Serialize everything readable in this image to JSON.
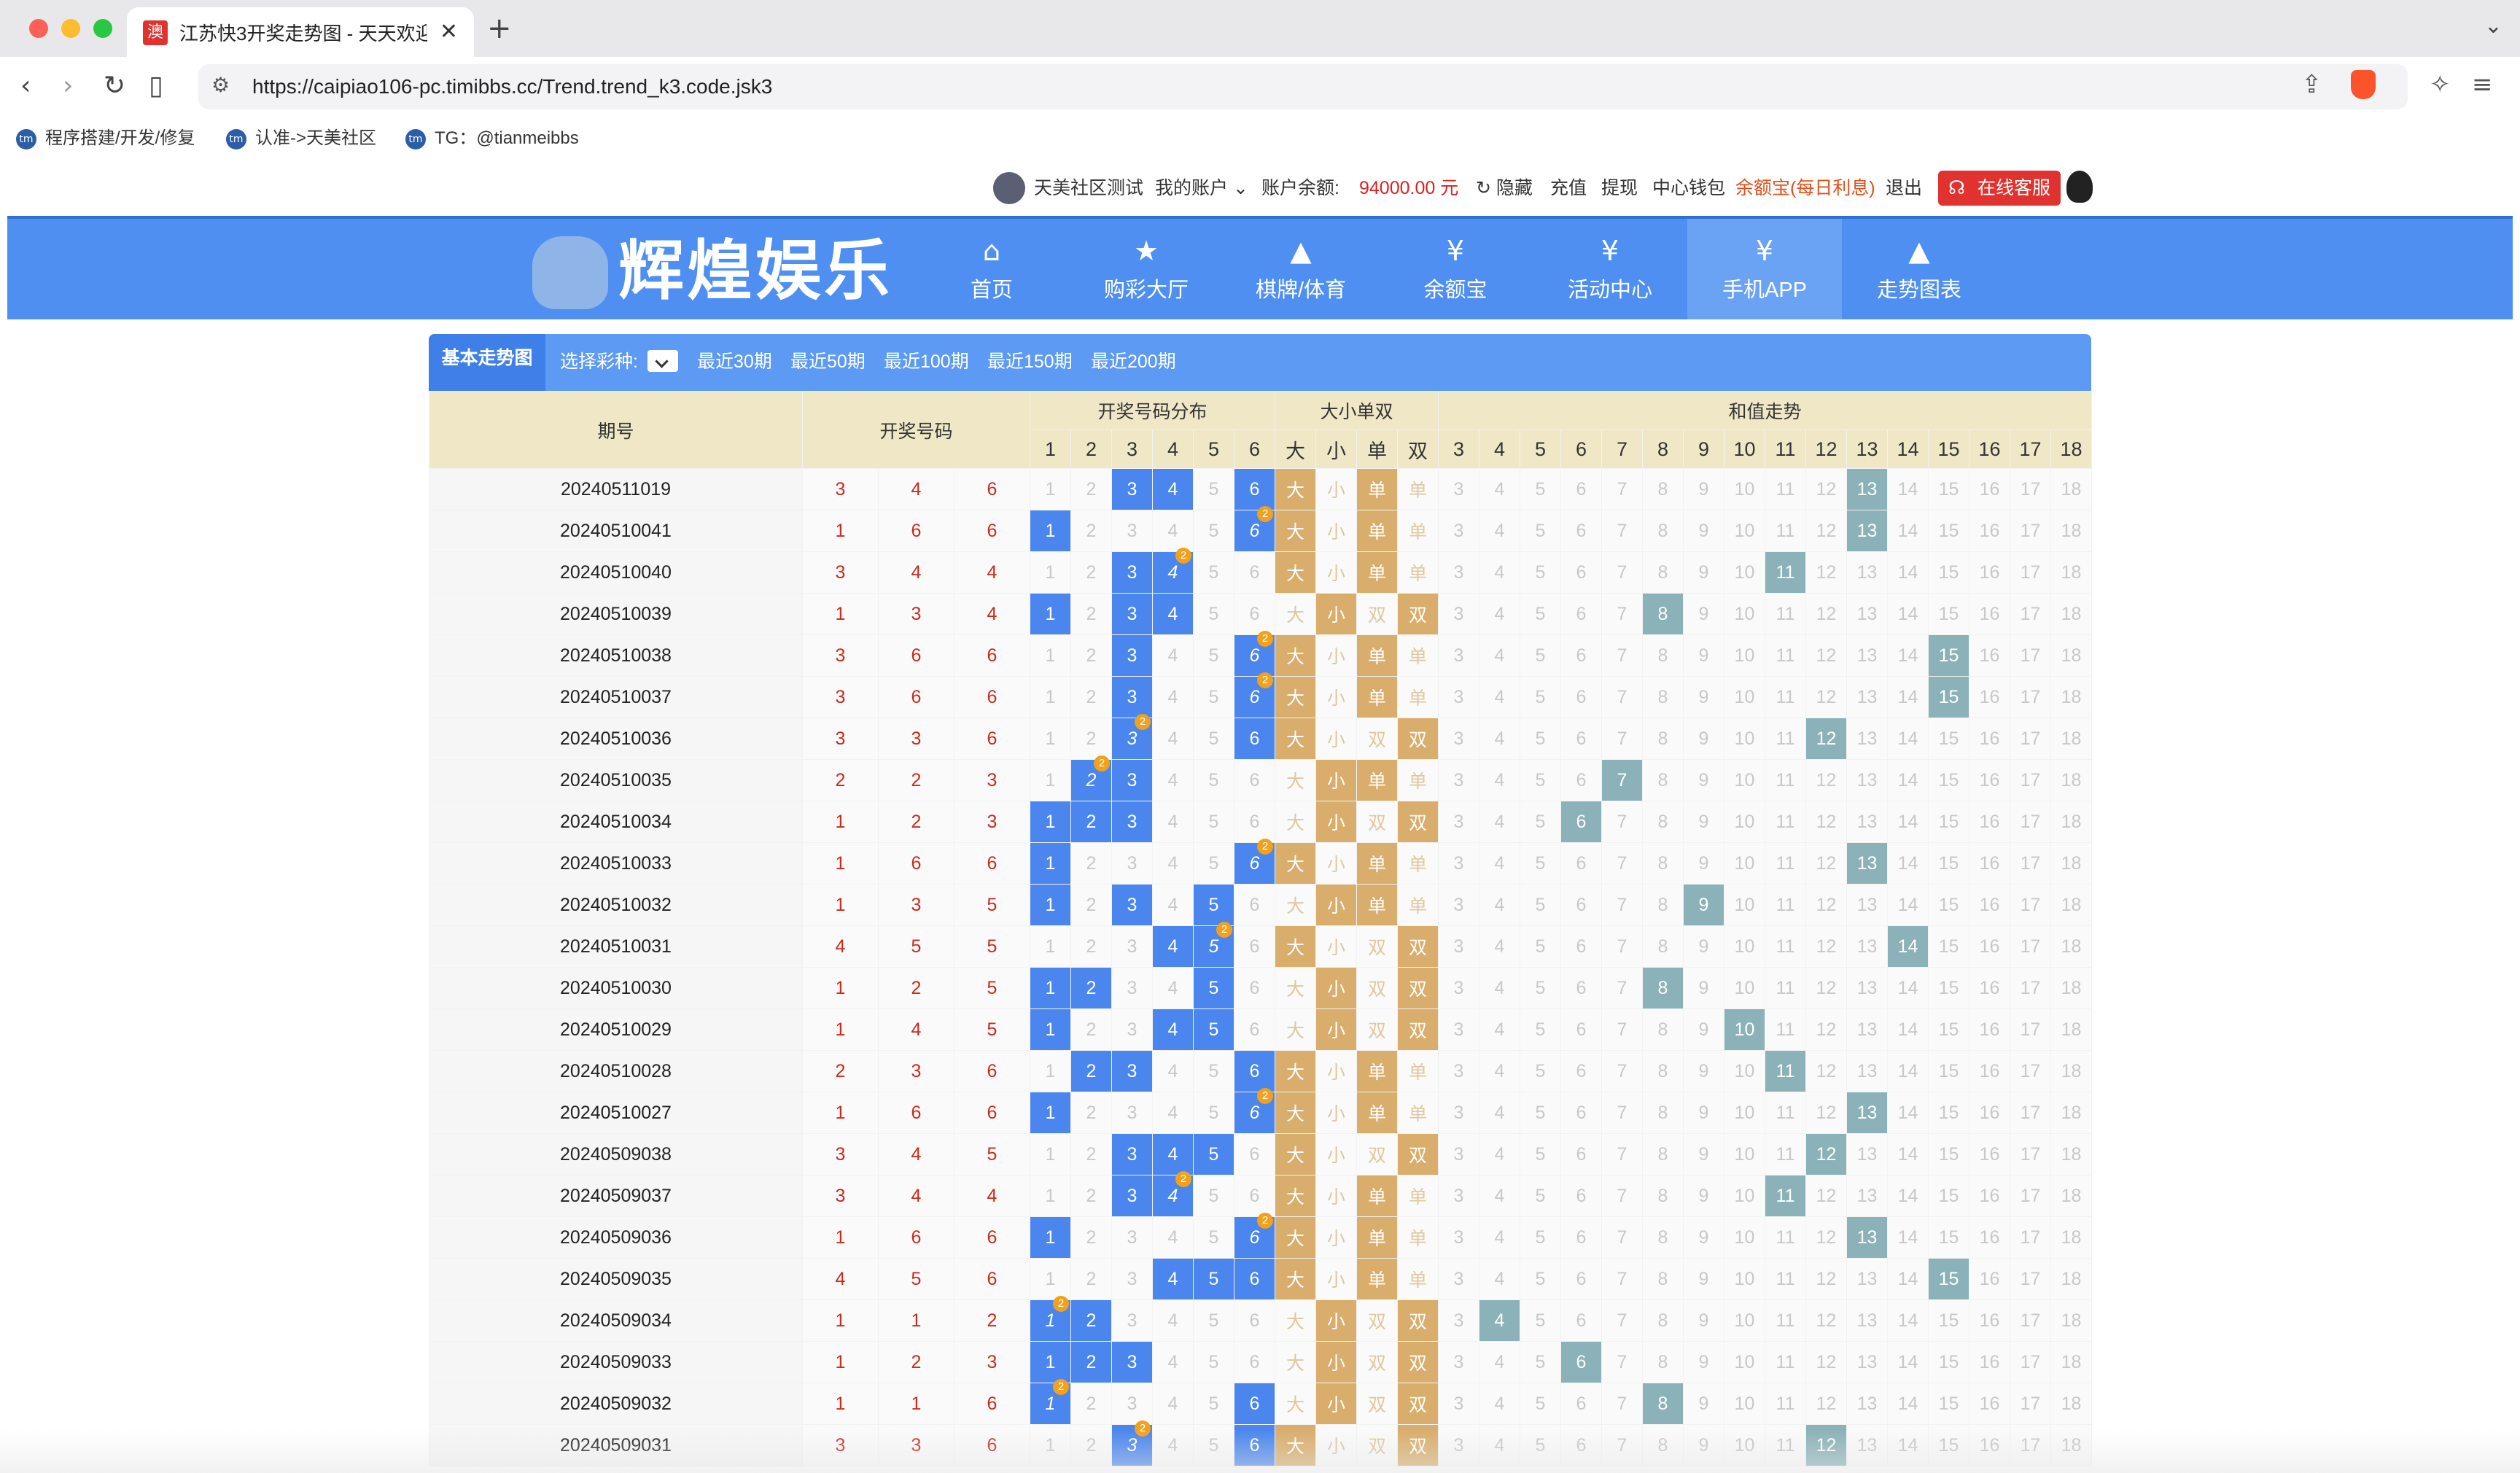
{
  "browser": {
    "tab_title": "江苏快3开奖走势图 - 天天欢迎",
    "tab_favicon": "澳",
    "url": "https://caipiao106-pc.timibbs.cc/Trend.trend_k3.code.jsk3",
    "bookmarks": [
      {
        "label": "程序搭建/开发/修复",
        "icon": "tm"
      },
      {
        "label": "认准->天美社区",
        "icon": "tm"
      },
      {
        "label": "TG：@tianmeibbs",
        "icon": "tm"
      }
    ],
    "icons": {
      "back": "arrow-left-icon",
      "forward": "arrow-right-icon",
      "reload": "reload-icon",
      "bookmark": "bookmark-icon",
      "site-info": "site-settings-icon",
      "share": "share-icon",
      "brave": "brave-shield-icon",
      "ai": "sparkle-icon",
      "menu": "menu-icon"
    }
  },
  "sitebar": {
    "username": "天美社区测试",
    "my_account": "我的账户",
    "balance_label": "账户余额:",
    "balance_value": "94000.00 元",
    "hide": "隐藏",
    "recharge": "充值",
    "withdraw": "提现",
    "wallet": "中心钱包",
    "yuebao": "余额宝(每日利息)",
    "logout": "退出",
    "service": "在线客服"
  },
  "mainnav": {
    "logo": "辉煌娱乐",
    "items": [
      {
        "label": "首页",
        "icon": "home-icon",
        "glyph": "⌂"
      },
      {
        "label": "购彩大厅",
        "icon": "star-icon",
        "glyph": "★"
      },
      {
        "label": "棋牌/体育",
        "icon": "triangle-icon",
        "glyph": "▲"
      },
      {
        "label": "余额宝",
        "icon": "money-bag-icon",
        "glyph": "¥"
      },
      {
        "label": "活动中心",
        "icon": "money-bag-icon",
        "glyph": "¥"
      },
      {
        "label": "手机APP",
        "icon": "money-bag-icon",
        "glyph": "¥",
        "active": true
      },
      {
        "label": "走势图表",
        "icon": "triangle-icon",
        "glyph": "▲"
      }
    ]
  },
  "trend_header": {
    "tab": "基本走势图",
    "select_label": "选择彩种:",
    "ranges": [
      "最近30期",
      "最近50期",
      "最近100期",
      "最近150期",
      "最近200期"
    ]
  },
  "table": {
    "col_qi": "期号",
    "col_kj": "开奖号码",
    "col_dist": "开奖号码分布",
    "col_dxds": "大小单双",
    "col_sum": "和值走势",
    "dist_heads": [
      "1",
      "2",
      "3",
      "4",
      "5",
      "6"
    ],
    "dxds_heads": [
      "大",
      "小",
      "单",
      "双"
    ],
    "sum_heads": [
      "3",
      "4",
      "5",
      "6",
      "7",
      "8",
      "9",
      "10",
      "11",
      "12",
      "13",
      "14",
      "15",
      "16",
      "17",
      "18"
    ],
    "rows": [
      {
        "qi": "20240511019",
        "nums": [
          3,
          4,
          6
        ]
      },
      {
        "qi": "20240510041",
        "nums": [
          1,
          6,
          6
        ]
      },
      {
        "qi": "20240510040",
        "nums": [
          3,
          4,
          4
        ]
      },
      {
        "qi": "20240510039",
        "nums": [
          1,
          3,
          4
        ]
      },
      {
        "qi": "20240510038",
        "nums": [
          3,
          6,
          6
        ]
      },
      {
        "qi": "20240510037",
        "nums": [
          3,
          6,
          6
        ]
      },
      {
        "qi": "20240510036",
        "nums": [
          3,
          3,
          6
        ]
      },
      {
        "qi": "20240510035",
        "nums": [
          2,
          2,
          3
        ]
      },
      {
        "qi": "20240510034",
        "nums": [
          1,
          2,
          3
        ]
      },
      {
        "qi": "20240510033",
        "nums": [
          1,
          6,
          6
        ]
      },
      {
        "qi": "20240510032",
        "nums": [
          1,
          3,
          5
        ]
      },
      {
        "qi": "20240510031",
        "nums": [
          4,
          5,
          5
        ]
      },
      {
        "qi": "20240510030",
        "nums": [
          1,
          2,
          5
        ]
      },
      {
        "qi": "20240510029",
        "nums": [
          1,
          4,
          5
        ]
      },
      {
        "qi": "20240510028",
        "nums": [
          2,
          3,
          6
        ]
      },
      {
        "qi": "20240510027",
        "nums": [
          1,
          6,
          6
        ]
      },
      {
        "qi": "20240509038",
        "nums": [
          3,
          4,
          5
        ]
      },
      {
        "qi": "20240509037",
        "nums": [
          3,
          4,
          4
        ]
      },
      {
        "qi": "20240509036",
        "nums": [
          1,
          6,
          6
        ]
      },
      {
        "qi": "20240509035",
        "nums": [
          4,
          5,
          6
        ]
      },
      {
        "qi": "20240509034",
        "nums": [
          1,
          1,
          2
        ]
      },
      {
        "qi": "20240509033",
        "nums": [
          1,
          2,
          3
        ]
      },
      {
        "qi": "20240509032",
        "nums": [
          1,
          1,
          6
        ]
      },
      {
        "qi": "20240509031",
        "nums": [
          3,
          3,
          6
        ]
      }
    ]
  },
  "colors": {
    "nav_blue": "#4e8ff1",
    "dist_highlight": "#4a86ee",
    "dxds_highlight": "#d9ad6c",
    "sum_highlight": "#8ab2b8",
    "badge": "#f2a11c",
    "draw_number": "#cc2a1a"
  }
}
